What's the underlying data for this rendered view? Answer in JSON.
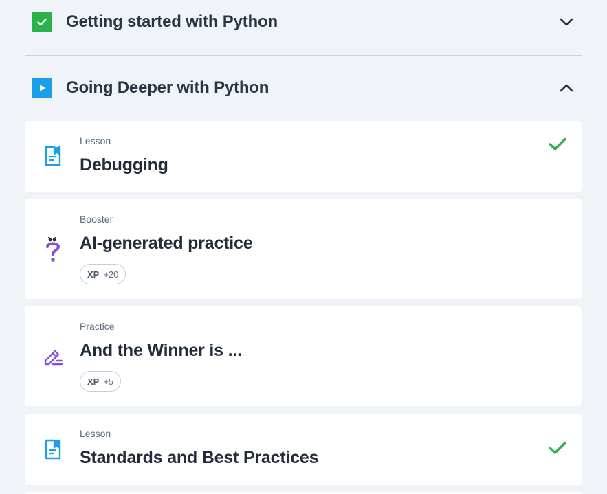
{
  "sections": [
    {
      "title": "Getting started with Python",
      "status": "completed",
      "expanded": false,
      "icon": "check-icon",
      "chevron": "chevron-down-icon"
    },
    {
      "title": "Going Deeper with Python",
      "status": "in-progress",
      "expanded": true,
      "icon": "play-icon",
      "chevron": "chevron-up-icon"
    }
  ],
  "items": [
    {
      "kind": "Lesson",
      "title": "Debugging",
      "icon": "lesson-document-icon",
      "completed": true
    },
    {
      "kind": "Booster",
      "title": "AI-generated practice",
      "icon": "question-mark-icon",
      "xp_label": "XP",
      "xp_value": "+20",
      "completed": false
    },
    {
      "kind": "Practice",
      "title": "And the Winner is ...",
      "icon": "pencil-icon",
      "xp_label": "XP",
      "xp_value": "+5",
      "completed": false
    },
    {
      "kind": "Lesson",
      "title": "Standards and Best Practices",
      "icon": "lesson-document-icon",
      "completed": true
    }
  ],
  "colors": {
    "background": "#f0f3f7",
    "card": "#ffffff",
    "completed_green": "#2bb24c",
    "play_blue": "#1aa0e6",
    "lesson_blue": "#1aa0e6",
    "booster_purple": "#8a4fd8"
  }
}
